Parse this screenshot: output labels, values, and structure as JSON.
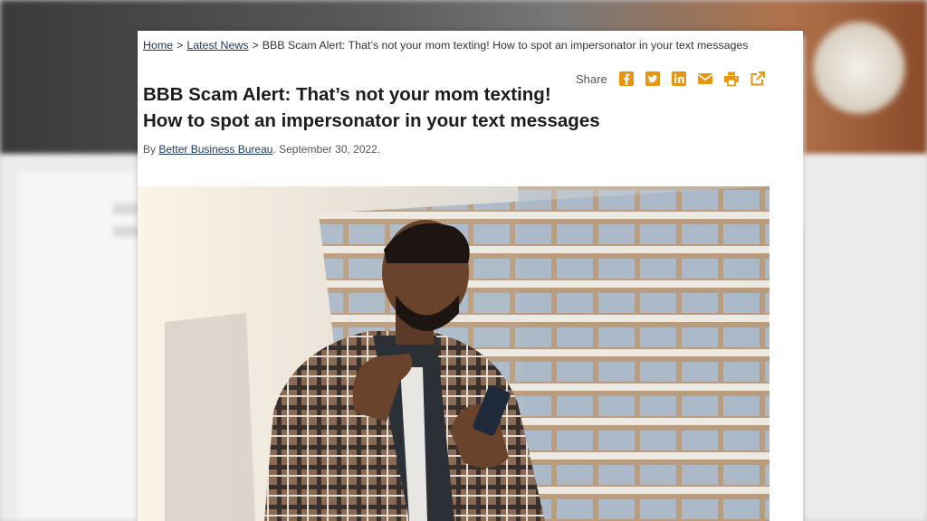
{
  "breadcrumb": {
    "home": "Home",
    "latest": "Latest News",
    "current": "BBB Scam Alert: That’s not your mom texting! How to spot an impersonator in your text messages",
    "separator": ">"
  },
  "share": {
    "label": "Share",
    "icons": [
      "facebook-icon",
      "twitter-icon",
      "linkedin-icon",
      "email-icon",
      "print-icon",
      "external-link-icon"
    ],
    "color": "#e8950f"
  },
  "article": {
    "title_line1": "BBB Scam Alert: That’s not your mom texting!",
    "title_line2": "How to spot an impersonator in your text messages",
    "by_prefix": "By",
    "author": "Better Business Bureau",
    "date_suffix": ". September 30, 2022."
  },
  "colors": {
    "link": "#1f3b63",
    "title": "#1c1c1c",
    "accent": "#e8950f"
  }
}
